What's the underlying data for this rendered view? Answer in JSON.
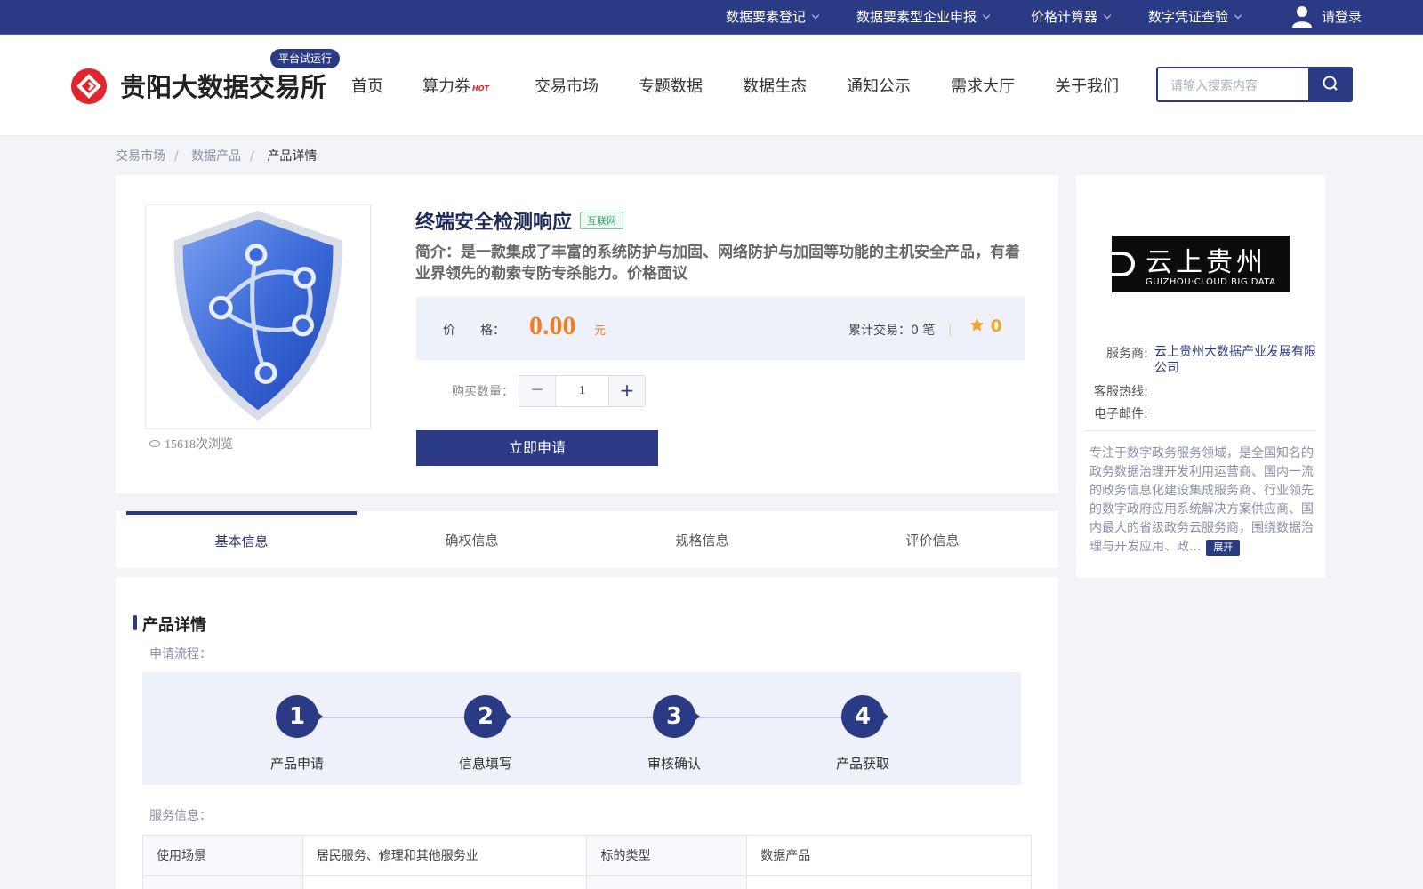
{
  "topbar": {
    "items": [
      "数据要素登记",
      "数据要素型企业申报",
      "价格计算器",
      "数字凭证查验"
    ],
    "login": "请登录"
  },
  "header": {
    "logo_text": "贵阳大数据交易所",
    "badge": "平台试运行",
    "nav": [
      "首页",
      "算力券",
      "交易市场",
      "专题数据",
      "数据生态",
      "通知公示",
      "需求大厅",
      "关于我们"
    ],
    "hot_label": "HOT",
    "search_placeholder": "请输入搜索内容"
  },
  "breadcrumb": [
    "交易市场",
    "数据产品",
    "产品详情"
  ],
  "product": {
    "title": "终端安全检测响应",
    "tag": "互联网",
    "intro": "简介：是一款集成了丰富的系统防护与加固、网络防护与加固等功能的主机安全产品，有着业界领先的勒索专防专杀能力。价格面议",
    "price_label": "价　　格：",
    "price": "0.00",
    "price_unit": "元",
    "trade_count": "累计交易：0 笔",
    "rating": "0",
    "views": "15618次浏览",
    "qty_label": "购买数量：",
    "qty": "1",
    "apply_label": "立即申请"
  },
  "tabs": [
    "基本信息",
    "确权信息",
    "规格信息",
    "评价信息"
  ],
  "detail": {
    "section_title": "产品详情",
    "flow_label": "申请流程：",
    "steps": [
      {
        "num": "1",
        "label": "产品申请"
      },
      {
        "num": "2",
        "label": "信息填写"
      },
      {
        "num": "3",
        "label": "审核确认"
      },
      {
        "num": "4",
        "label": "产品获取"
      }
    ],
    "service_label": "服务信息：",
    "table": [
      {
        "k1": "使用场景",
        "v1": "居民服务、修理和其他服务业",
        "k2": "标的类型",
        "v2": "数据产品"
      }
    ]
  },
  "sidebar": {
    "logo_cn": "云上贵州",
    "logo_en": "GUIZHOU·CLOUD  BIG DATA",
    "provider_label": "服务商:",
    "provider": "云上贵州大数据产业发展有限公司",
    "hotline_label": "客服热线:",
    "email_label": "电子邮件:",
    "desc": "专注于数字政务服务领域，是全国知名的政务数据治理开发利用运营商、国内一流的政务信息化建设集成服务商、行业领先的数字政府应用系统解决方案供应商、国内最大的省级政务云服务商，围绕数据治理与开发应用、政...",
    "expand_label": "展开"
  },
  "colors": {
    "brand": "#2b3a85",
    "accent_price": "#f0801f",
    "logo_red": "#e0262c"
  }
}
